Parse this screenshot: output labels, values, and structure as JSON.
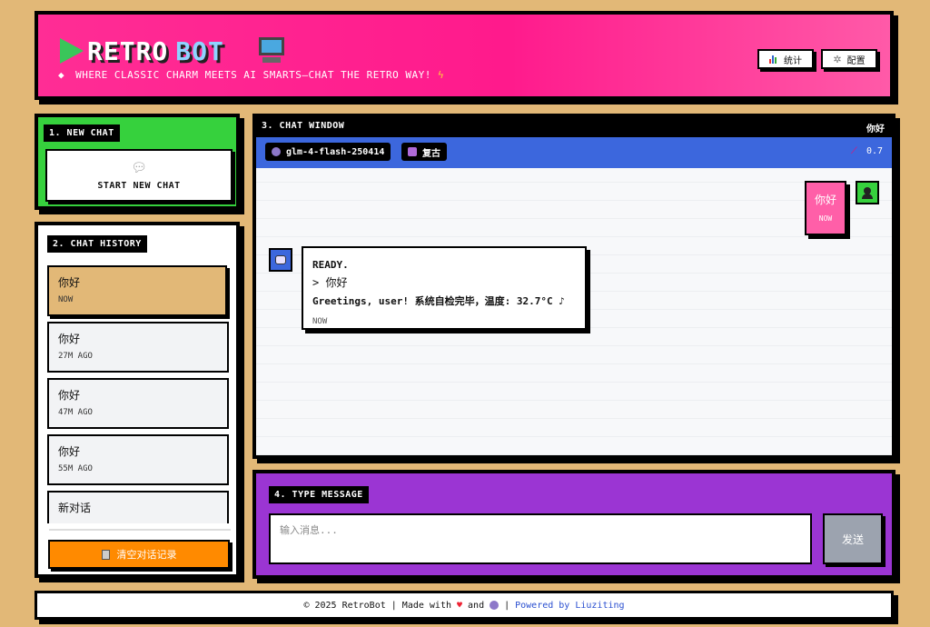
{
  "header": {
    "logo_word_1": "RETRO",
    "logo_word_2": "BOT",
    "tagline": "WHERE CLASSIC CHARM MEETS AI SMARTS—CHAT THE RETRO WAY!",
    "stats_label": "统计",
    "config_label": "配置"
  },
  "new_chat": {
    "section_label": "1. NEW CHAT",
    "button_label": "START NEW CHAT"
  },
  "history": {
    "section_label": "2. CHAT HISTORY",
    "items": [
      {
        "title": "你好",
        "time": "NOW",
        "active": true
      },
      {
        "title": "你好",
        "time": "27M AGO",
        "active": false
      },
      {
        "title": "你好",
        "time": "47M AGO",
        "active": false
      },
      {
        "title": "你好",
        "time": "55M AGO",
        "active": false
      },
      {
        "title": "新对话",
        "time": "",
        "active": false
      }
    ],
    "clear_label": "清空对话记录"
  },
  "chat": {
    "section_label": "3. CHAT WINDOW",
    "current_title": "你好",
    "model": "glm-4-flash-250414",
    "mode": "复古",
    "temperature": "0.7",
    "messages": {
      "user": {
        "text": "你好",
        "time": "NOW"
      },
      "bot": {
        "line1": "READY.",
        "line2_prefix": "> ",
        "line2_text": "你好",
        "line3": "Greetings, user! 系统自检完毕，温度: 32.7°C ♪",
        "time": "NOW"
      }
    }
  },
  "composer": {
    "section_label": "4. TYPE MESSAGE",
    "placeholder": "输入消息...",
    "send_label": "发送"
  },
  "footer": {
    "copy": "© 2025 RetroBot | Made with",
    "and": "and",
    "sep": "|",
    "link": "Powered by Liuziting"
  },
  "colors": {
    "header_pink": "#ff2d95",
    "new_chat_green": "#36d13d",
    "chat_bar_blue": "#3c67dd",
    "composer_purple": "#9b35d3",
    "clear_orange": "#ff8a00",
    "page_bg": "#e2b877"
  }
}
